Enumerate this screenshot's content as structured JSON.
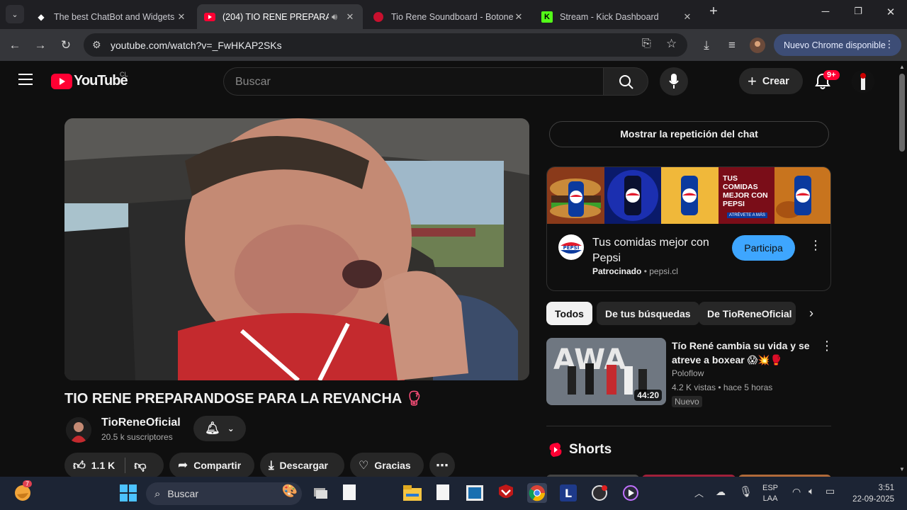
{
  "browser": {
    "tabs": [
      {
        "title": "The best ChatBot and Widgets f",
        "favicon": "diamond-logo"
      },
      {
        "title": "(204) TIO RENE PREPARANI",
        "favicon": "youtube-logo"
      },
      {
        "title": "Tio Rene Soundboard - Botone",
        "favicon": "red-circle-logo"
      },
      {
        "title": "Stream - Kick Dashboard",
        "favicon": "kick-logo"
      }
    ],
    "url": "youtube.com/watch?v=_FwHKAP2SKs",
    "update_label": "Nuevo Chrome disponible"
  },
  "youtube": {
    "logo_text": "YouTube",
    "country": "CL",
    "search_placeholder": "Buscar",
    "create_label": "Crear",
    "notif_count": "9+",
    "video_title": "TIO RENE PREPARANDOSE PARA LA REVANCHA",
    "channel_name": "TioReneOficial",
    "subscribers": "20.5 k suscriptores",
    "likes": "1.1 K",
    "share_label": "Compartir",
    "download_label": "Descargar",
    "thanks_label": "Gracias"
  },
  "sidebar": {
    "chat_replay_label": "Mostrar la repetición del chat",
    "ad": {
      "banner_text": "TUS COMIDAS MEJOR CON PEPSI",
      "banner_sub": "ATRÉVETE A MÁS",
      "brand_badge": "PEPSI",
      "title": "Tus comidas mejor con Pepsi",
      "sponsored": "Patrocinado",
      "domain": "pepsi.cl",
      "cta": "Participa"
    },
    "chips": [
      "Todos",
      "De tus búsquedas",
      "De TioReneOficial"
    ],
    "recommended": {
      "title": "Tío René cambia su vida y se atreve a boxear",
      "title_emoji": "😱💥🥊",
      "channel": "Poloflow",
      "meta": "4.2 K vistas • hace 5 horas",
      "duration": "44:20",
      "badge": "Nuevo"
    },
    "shorts_label": "Shorts"
  },
  "taskbar": {
    "search_placeholder": "Buscar",
    "widget_badge": "7",
    "lang_top": "ESP",
    "lang_bottom": "LAA",
    "time": "3:51",
    "date": "22-09-2025"
  },
  "colors": {
    "yt_red": "#ff0033",
    "cta_blue": "#3ea6ff",
    "pepsi_blue": "#0b3a9e",
    "taskbar_bg": "#1c2434"
  }
}
